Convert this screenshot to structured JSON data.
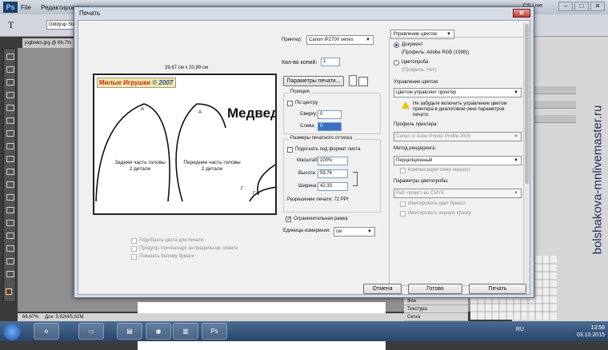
{
  "photoshop": {
    "logo": "Ps",
    "menu": [
      "File",
      "Редактирование"
    ],
    "cs_live": "CS Live",
    "doc_tab": "jogbwko.jpg @ 66,7%",
    "font_field": "Giddyup Std",
    "zoom": "66,67%",
    "doc_info": "Док: 5,62M/5,62M",
    "layers": [
      "Фон",
      "Текстура",
      "Сетка"
    ]
  },
  "dialog": {
    "title": "Печать",
    "close": "✕",
    "paper_size": "29,67 см x 20,99 см",
    "preview": {
      "brand_part1": "Милые Игрушки",
      "brand_part2": "© 2007",
      "word": "Медвед",
      "left_text": "Задняя часть головы\n2 детали",
      "right_text": "Передняя часть головы\n2 детали",
      "letter_a1": "А",
      "letter_a2": "А",
      "letter_g1": "Г",
      "letter_g2": "Г"
    },
    "printer_label": "Принтер:",
    "printer_value": "Canon iP2700 series",
    "copies_label": "Кол-во копий:",
    "copies_value": "1",
    "print_settings_button": "Параметры печати...",
    "position_title": "Позиция",
    "center_label": "По центру",
    "top_label": "Сверху:",
    "top_value": "0",
    "left_label": "Слева:",
    "left_value": "0",
    "print_size_title": "Размеры печатного оттиска",
    "fit_label": "Подогнать под формат листа",
    "scale_label": "Масштаб:",
    "scale_value": "100%",
    "height_label": "Высота:",
    "height_value": "59,76",
    "width_label": "Ширина:",
    "width_value": "42,33",
    "resolution_text": "Разрешение печати: 72 PPI",
    "bbox_label": "Ограничительная рамка",
    "units_label": "Единицы измерения:",
    "units_value": "см",
    "bottom_checks": [
      "Подобрать цвета для печати",
      "Предупр. при выходе за пределы цв. охвата",
      "Показать белому бумаги"
    ],
    "color_mgmt_dropdown": "Управление цветом",
    "document_radio": "Документ",
    "document_profile": "(Профиль: Adobe RGB (1998))",
    "proof_radio": "Цветопроба",
    "proof_profile": "(Профиль: Нет)",
    "color_handling_label": "Управление цветом:",
    "color_handling_value": "Цветом управляет принтер",
    "warning_text": "Не забудьте включить управление цветом принтера в диалоговом окне параметров печати.",
    "printer_profile_label": "Профиль принтера:",
    "printer_profile_value": "Canon IJ Color Printer Profile 2005",
    "rendering_label": "Метод рендеринга:",
    "rendering_value": "Перцепционный",
    "bpc_label": "Компенсация точки черного",
    "proof_setup_label": "Параметры цветопробы:",
    "proof_setup_value": "Раб. проист-во CMYK",
    "simulate_paper": "Имитировать цвет бумаги",
    "simulate_black": "Имитировать черную краску",
    "cancel_button": "Отмена",
    "done_button": "Готово",
    "print_button": "Печать"
  },
  "taskbar": {
    "lang": "RU",
    "time": "13:58",
    "date": "03.10.2015"
  },
  "watermark": "bolshakova-mnlivemaster.ru"
}
